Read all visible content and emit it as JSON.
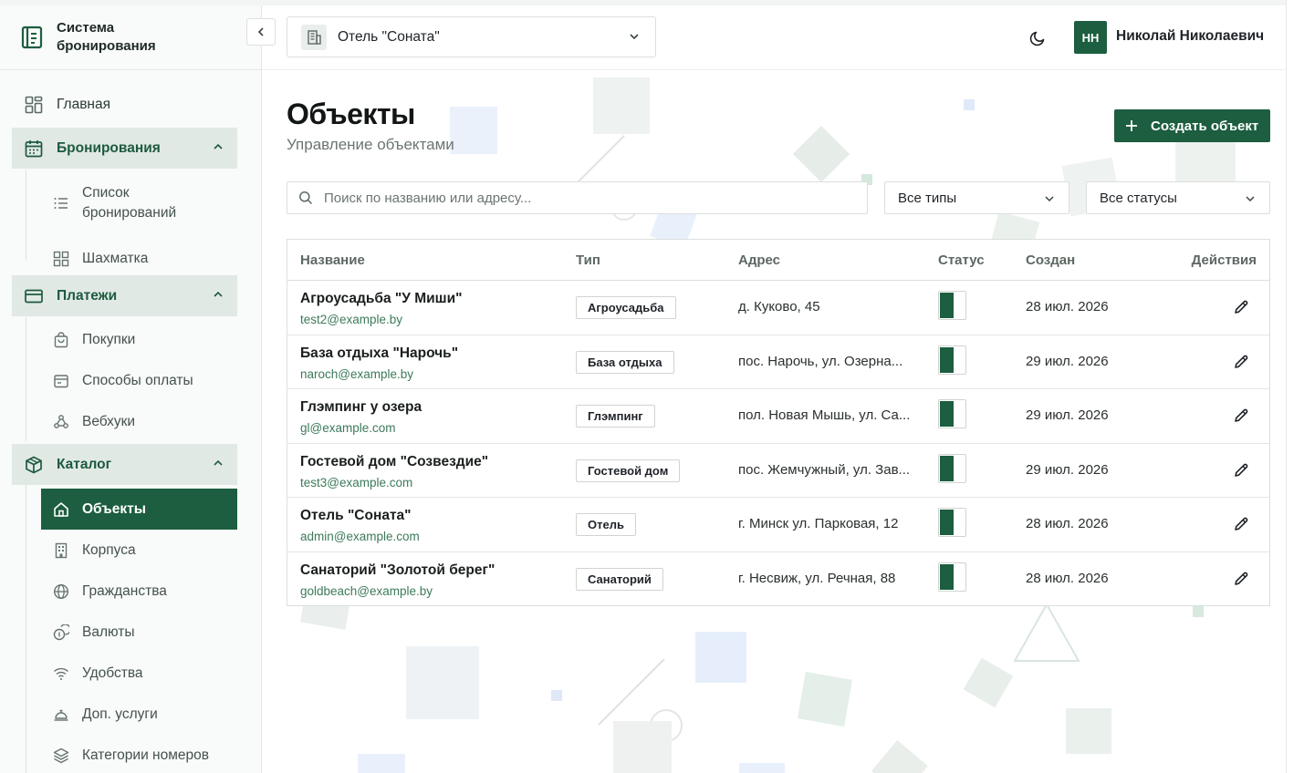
{
  "brand": {
    "title": "Система бронирования"
  },
  "header": {
    "hotel_select": "Отель \"Соната\"",
    "user_initials": "НН",
    "user_name": "Николай Николаевич"
  },
  "sidebar": {
    "home": "Главная",
    "bookings": {
      "label": "Бронирования",
      "items": [
        "Список бронирований",
        "Шахматка"
      ]
    },
    "payments": {
      "label": "Платежи",
      "items": [
        "Покупки",
        "Способы оплаты",
        "Вебхуки"
      ]
    },
    "catalog": {
      "label": "Каталог",
      "items": [
        "Объекты",
        "Корпуса",
        "Гражданства",
        "Валюты",
        "Удобства",
        "Доп. услуги",
        "Категории номеров"
      ]
    }
  },
  "page": {
    "title": "Объекты",
    "subtitle": "Управление объектами",
    "create_label": "Создать объект",
    "search_placeholder": "Поиск по названию или адресу...",
    "type_filter": "Все типы",
    "status_filter": "Все статусы"
  },
  "table": {
    "columns": [
      "Название",
      "Тип",
      "Адрес",
      "Статус",
      "Создан",
      "Действия"
    ],
    "rows": [
      {
        "name": "Агроусадьба \"У Миши\"",
        "email": "test2@example.by",
        "type": "Агроусадьба",
        "address": "д. Куково, 45",
        "active": true,
        "created": "28 июл. 2026"
      },
      {
        "name": "База отдыха \"Нарочь\"",
        "email": "naroch@example.by",
        "type": "База отдыха",
        "address": "пос. Нарочь, ул. Озерна...",
        "active": true,
        "created": "29 июл. 2026"
      },
      {
        "name": "Глэмпинг у озера",
        "email": "gl@example.com",
        "type": "Глэмпинг",
        "address": "пол. Новая Мышь, ул. Са...",
        "active": true,
        "created": "29 июл. 2026"
      },
      {
        "name": "Гостевой дом \"Созвездие\"",
        "email": "test3@example.com",
        "type": "Гостевой дом",
        "address": "пос. Жемчужный, ул. Зав...",
        "active": true,
        "created": "29 июл. 2026"
      },
      {
        "name": "Отель \"Соната\"",
        "email": "admin@example.com",
        "type": "Отель",
        "address": "г. Минск ул. Парковая, 12",
        "active": true,
        "created": "28 июл. 2026"
      },
      {
        "name": "Санаторий \"Золотой берег\"",
        "email": "goldbeach@example.by",
        "type": "Санаторий",
        "address": "г. Несвиж, ул. Речная, 88",
        "active": true,
        "created": "28 июл. 2026"
      }
    ]
  },
  "colors": {
    "accent": "#1c5e3f",
    "group_bg": "#e1e9e4"
  }
}
